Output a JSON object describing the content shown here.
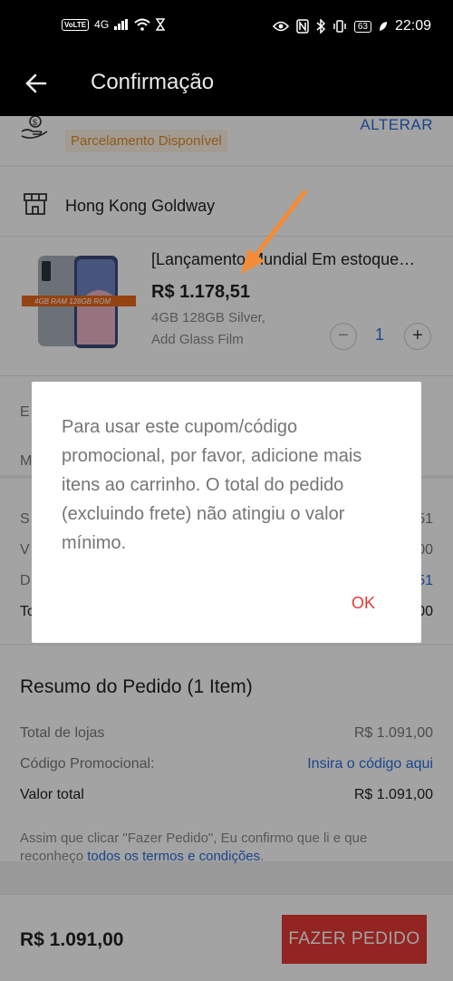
{
  "status_bar": {
    "volte": "VoLTE",
    "network": "4G",
    "battery": "63",
    "time": "22:09"
  },
  "app_bar": {
    "title": "Confirmação"
  },
  "installment": {
    "badge": "Parcelamento Disponível",
    "change": "ALTERAR"
  },
  "store": {
    "name": "Hong Kong Goldway",
    "product": {
      "title": "[Lançamento Mundial Em estoque…",
      "image_banner": "4GB RAM 128GB ROM",
      "price": "R$ 1.178,51",
      "variant_line1": "4GB 128GB Silver,",
      "variant_line2": "Add Glass Film",
      "quantity": "1",
      "minus": "−",
      "plus": "+"
    },
    "partial_rows": {
      "e": "E",
      "m": "M",
      "s": "S",
      "v": "V",
      "d": "D",
      "to": "To",
      "r1": "51",
      "r2": "00",
      "r3": "51",
      "r4": "00"
    }
  },
  "summary": {
    "title": "Resumo do Pedido (1 Item)",
    "rows": [
      {
        "label": "Total de lojas",
        "value": "R$ 1.091,00"
      },
      {
        "label": "Código Promocional:",
        "value": "Insira o código aqui"
      },
      {
        "label": "Valor total",
        "value": "R$ 1.091,00"
      }
    ]
  },
  "legal": {
    "text": "Assim que clicar \"Fazer Pedido\", Eu confirmo que li e que reconheço ",
    "link": "todos os termos e condições",
    "end": "."
  },
  "bottom_bar": {
    "total": "R$ 1.091,00",
    "place_order": "FAZER PEDIDO"
  },
  "dialog": {
    "message": "Para usar este cupom/código promocional, por favor, adicione mais itens ao carrinho. O total do pedido (excluindo frete) não atingiu o valor mínimo.",
    "ok": "OK"
  },
  "colors": {
    "accent_red": "#e53935",
    "link_blue": "#2b6dd8",
    "installment_orange": "#e08b2a",
    "annotation_arrow": "#f28c38"
  }
}
